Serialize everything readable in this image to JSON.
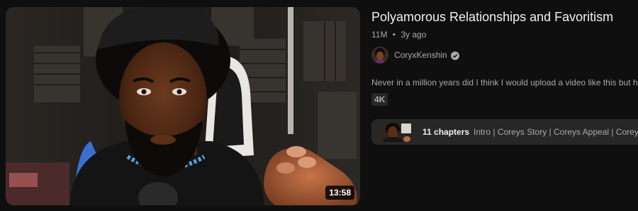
{
  "video": {
    "title": "Polyamorous Relationships and Favoritism",
    "views": "11M",
    "separator": "•",
    "age": "3y ago",
    "duration": "13:58",
    "quality_badge": "4K",
    "description": "Never in a million years did I think I would upload a video like this but he"
  },
  "channel": {
    "name": "CoryxKenshin",
    "verified_icon": "verified-check-icon"
  },
  "chapters": {
    "count_label": "11 chapters",
    "list_text": "Intro | Coreys Story | Coreys Appeal | Coreys"
  },
  "colors": {
    "background": "#0f0f0f",
    "title": "#f1f1f1",
    "secondary_text": "#aaaaaa",
    "chip_background": "#272727"
  }
}
